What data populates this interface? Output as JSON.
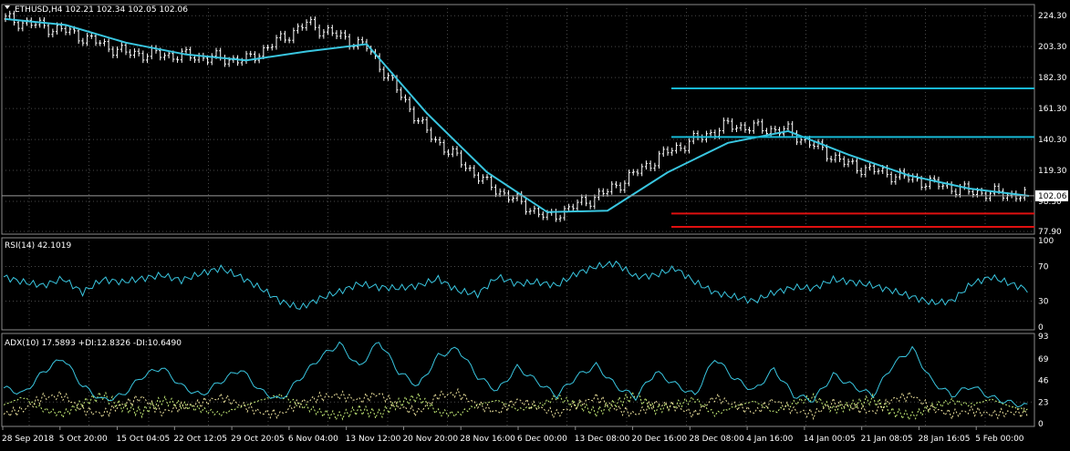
{
  "colors": {
    "background": "#000000",
    "grid": "#4a4a4a",
    "frame": "#8a8a8a",
    "candle": "#ffffff",
    "ma": "#39c6e0",
    "level_cyan": "#17b8d4",
    "level_red": "#e01010",
    "current_price_line": "#9a9a9a",
    "rsi_line": "#39c6e0",
    "adx_line": "#39c6e0",
    "di_plus": "#c8f07a",
    "di_minus": "#f0e6a0"
  },
  "header": {
    "symbol_line": "ETHUSD,H4  102.21 102.34 102.05 102.06",
    "menu_icon": "triangle-down-icon"
  },
  "chart_data": [
    {
      "type": "line",
      "name": "ETHUSD,H4",
      "ylim": [
        77.9,
        230
      ],
      "yticks": [
        "224.30",
        "203.30",
        "182.30",
        "161.30",
        "140.30",
        "119.30",
        "98.30",
        "77.90"
      ],
      "current_price": "102.06",
      "x": [
        "28 Sep 2018",
        "5 Oct 20:00",
        "15 Oct 04:05",
        "22 Oct 12:05",
        "29 Oct 20:05",
        "6 Nov 04:00",
        "13 Nov 12:00",
        "20 Nov 20:00",
        "28 Nov 16:00",
        "6 Dec 00:00",
        "13 Dec 08:00",
        "20 Dec 16:00",
        "28 Dec 08:00",
        "4 Jan 16:00",
        "14 Jan 00:05",
        "21 Jan 08:05",
        "28 Jan 16:05",
        "5 Feb 00:00"
      ],
      "series": [
        {
          "values": [
            222,
            214,
            199,
            197,
            194,
            219,
            203,
            145,
            110,
            87,
            105,
            132,
            150,
            146,
            123,
            114,
            105,
            102
          ]
        },
        {
          "values": [
            222,
            218,
            206,
            198,
            194,
            200,
            205,
            158,
            118,
            91,
            92,
            118,
            138,
            146,
            130,
            116,
            107,
            102
          ]
        }
      ],
      "levels_cyan": [
        175,
        142
      ],
      "levels_red": [
        90,
        81
      ]
    },
    {
      "type": "line",
      "name": "RSI(14)",
      "header": "RSI(14) 42.1019",
      "ylim": [
        0,
        100
      ],
      "yticks": [
        "100",
        "70",
        "30",
        "0"
      ],
      "values": [
        58,
        52,
        48,
        56,
        40,
        55,
        52,
        56,
        60,
        54,
        62,
        68,
        58,
        45,
        30,
        22,
        33,
        41,
        50,
        46,
        45,
        48,
        56,
        42,
        38,
        58,
        50,
        52,
        48,
        62,
        70,
        74,
        58,
        60,
        68,
        52,
        40,
        35,
        30,
        40,
        46,
        45,
        55,
        52,
        48,
        42,
        35,
        28,
        30,
        50,
        58,
        50,
        42
      ]
    },
    {
      "type": "line",
      "name": "ADX(10)",
      "header": "ADX(10) 17.5893 +DI:12.8326 -DI:10.6490",
      "ylim": [
        0,
        93
      ],
      "yticks": [
        "93",
        "69",
        "46",
        "23",
        "0"
      ],
      "adx": [
        38,
        32,
        55,
        70,
        40,
        25,
        30,
        50,
        60,
        40,
        30,
        45,
        58,
        35,
        25,
        48,
        70,
        85,
        60,
        88,
        55,
        40,
        72,
        80,
        50,
        35,
        60,
        45,
        30,
        50,
        62,
        40,
        28,
        55,
        42,
        30,
        70,
        48,
        35,
        58,
        30,
        25,
        52,
        40,
        30,
        62,
        80,
        45,
        30,
        40,
        28,
        22,
        18
      ],
      "di_plus": [
        20,
        28,
        15,
        10,
        22,
        30,
        18,
        12,
        25,
        20,
        15,
        10,
        18,
        25,
        30,
        20,
        12,
        8,
        15,
        10,
        22,
        28,
        12,
        10,
        20,
        25,
        15,
        18,
        28,
        20,
        12,
        22,
        30,
        15,
        20,
        26,
        10,
        18,
        24,
        12,
        22,
        28,
        15,
        20,
        26,
        12,
        8,
        18,
        24,
        20,
        26,
        18,
        13
      ],
      "di_minus": [
        10,
        15,
        28,
        30,
        15,
        10,
        20,
        28,
        12,
        18,
        22,
        28,
        20,
        12,
        10,
        22,
        28,
        30,
        25,
        32,
        18,
        12,
        30,
        32,
        20,
        12,
        25,
        18,
        10,
        20,
        28,
        16,
        10,
        22,
        18,
        10,
        28,
        20,
        12,
        25,
        14,
        10,
        22,
        18,
        12,
        26,
        30,
        16,
        10,
        14,
        10,
        12,
        11
      ]
    }
  ]
}
